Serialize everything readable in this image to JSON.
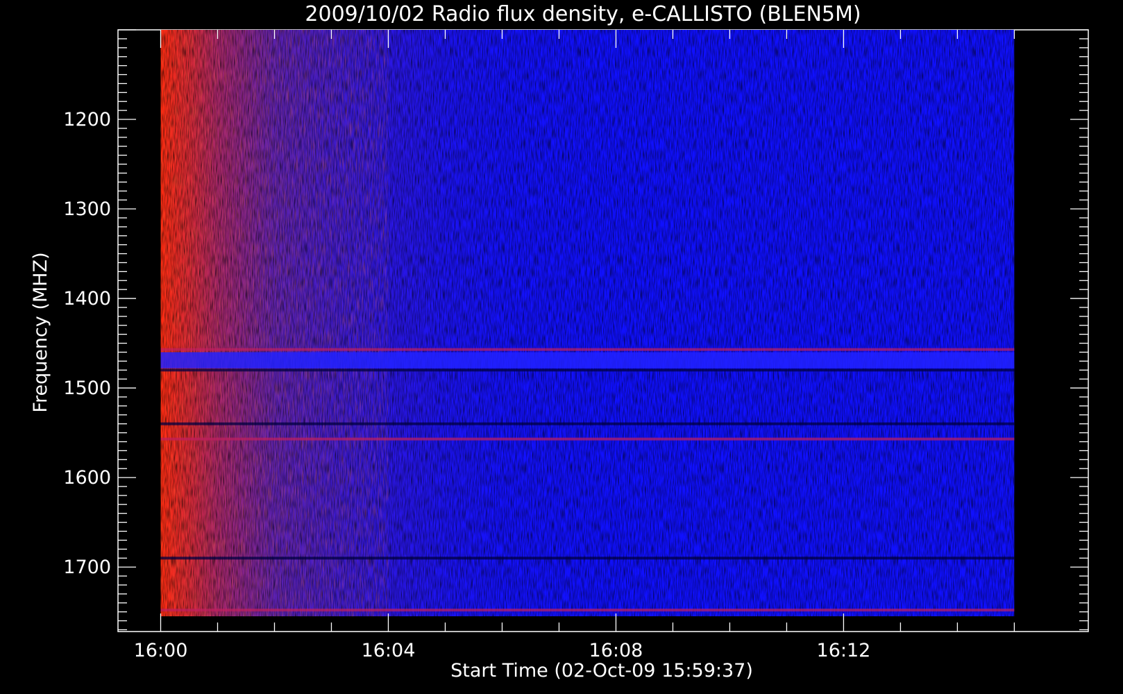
{
  "chart_data": {
    "type": "heatmap",
    "title": "2009/10/02  Radio flux density, e-CALLISTO (BLEN5M)",
    "xlabel": "Start Time (02-Oct-09 15:59:37)",
    "ylabel": "Frequency (MHZ)",
    "x_range": [
      "16:00",
      "16:15"
    ],
    "xlim_minutes": [
      -0.75,
      16.3
    ],
    "x_ticks": [
      {
        "value": 0,
        "label": "16:00"
      },
      {
        "value": 4,
        "label": "16:04"
      },
      {
        "value": 8,
        "label": "16:08"
      },
      {
        "value": 12,
        "label": "16:12"
      }
    ],
    "x_minor_step_minutes": 1,
    "y_range_mhz": [
      1100,
      1755
    ],
    "ylim_mhz": [
      1100,
      1772
    ],
    "y_inverted": true,
    "y_ticks": [
      {
        "value": 1200,
        "label": "1200"
      },
      {
        "value": 1300,
        "label": "1300"
      },
      {
        "value": 1400,
        "label": "1400"
      },
      {
        "value": 1500,
        "label": "1500"
      },
      {
        "value": 1600,
        "label": "1600"
      },
      {
        "value": 1700,
        "label": "1700"
      }
    ],
    "y_minor_step_mhz": 10,
    "colormap": {
      "low": "#1010ff",
      "mid": "#5a20b0",
      "high": "#ff2a10"
    },
    "intensity_profile": {
      "time_minutes": [
        0,
        0.5,
        1,
        2,
        3,
        4,
        5,
        6,
        8,
        15
      ],
      "level": [
        1.0,
        0.88,
        0.72,
        0.5,
        0.32,
        0.18,
        0.08,
        0.03,
        0.0,
        0.0
      ]
    },
    "features": [
      {
        "name": "bright band",
        "freq_mhz": 1457,
        "intensity": "high"
      },
      {
        "name": "quiet band",
        "freq_range_mhz": [
          1460,
          1478
        ],
        "intensity": "low"
      },
      {
        "name": "dark band",
        "freq_mhz": 1480,
        "intensity": "low"
      },
      {
        "name": "dark band",
        "freq_mhz": 1540,
        "intensity": "low"
      },
      {
        "name": "bright band",
        "freq_mhz": 1557,
        "intensity": "high"
      },
      {
        "name": "dark band",
        "freq_mhz": 1690,
        "intensity": "low"
      },
      {
        "name": "bright band",
        "freq_mhz": 1748,
        "intensity": "high"
      }
    ]
  }
}
